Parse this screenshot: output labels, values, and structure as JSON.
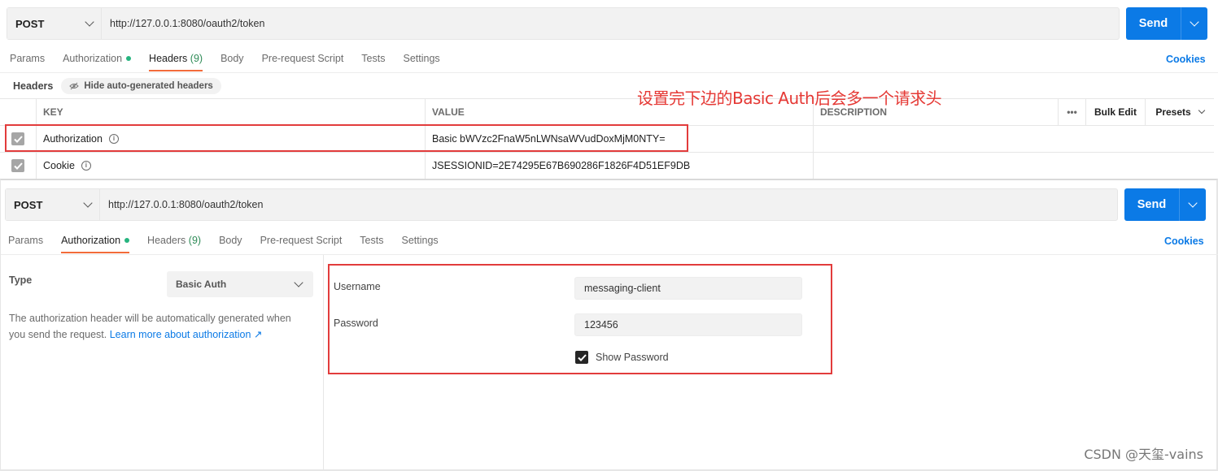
{
  "top": {
    "method": "POST",
    "url": "http://127.0.0.1:8080/oauth2/token",
    "send_label": "Send",
    "tabs": [
      {
        "label": "Params"
      },
      {
        "label": "Authorization"
      },
      {
        "label": "Headers",
        "count": "(9)"
      },
      {
        "label": "Body"
      },
      {
        "label": "Pre-request Script"
      },
      {
        "label": "Tests"
      },
      {
        "label": "Settings"
      }
    ],
    "cookies": "Cookies",
    "headers_label": "Headers",
    "hide_auto": "Hide auto-generated headers",
    "table": {
      "columns": {
        "key": "KEY",
        "value": "VALUE",
        "description": "DESCRIPTION",
        "more": "•••",
        "bulk_edit": "Bulk Edit",
        "presets": "Presets"
      },
      "rows": [
        {
          "key": "Authorization",
          "value": "Basic bWVzc2FnaW5nLWNsaWVudDoxMjM0NTY="
        },
        {
          "key": "Cookie",
          "value": "JSESSIONID=2E74295E67B690286F1826F4D51EF9DB"
        }
      ]
    },
    "annotation": "设置完下边的Basic Auth后会多一个请求头"
  },
  "bottom": {
    "method": "POST",
    "url": "http://127.0.0.1:8080/oauth2/token",
    "send_label": "Send",
    "tabs": [
      {
        "label": "Params"
      },
      {
        "label": "Authorization"
      },
      {
        "label": "Headers",
        "count": "(9)"
      },
      {
        "label": "Body"
      },
      {
        "label": "Pre-request Script"
      },
      {
        "label": "Tests"
      },
      {
        "label": "Settings"
      }
    ],
    "cookies": "Cookies",
    "type_label": "Type",
    "type_value": "Basic Auth",
    "desc_text": "The authorization header will be automatically generated when you send the request.",
    "desc_link": "Learn more about authorization ↗",
    "username_label": "Username",
    "username_value": "messaging-client",
    "password_label": "Password",
    "password_value": "123456",
    "show_password": "Show Password"
  },
  "watermark": "CSDN @天玺-vains",
  "colors": {
    "accent": "#0b7ae6",
    "active_tab": "#f26b3a",
    "highlight": "#e23c3c",
    "dot": "#26b47f"
  }
}
